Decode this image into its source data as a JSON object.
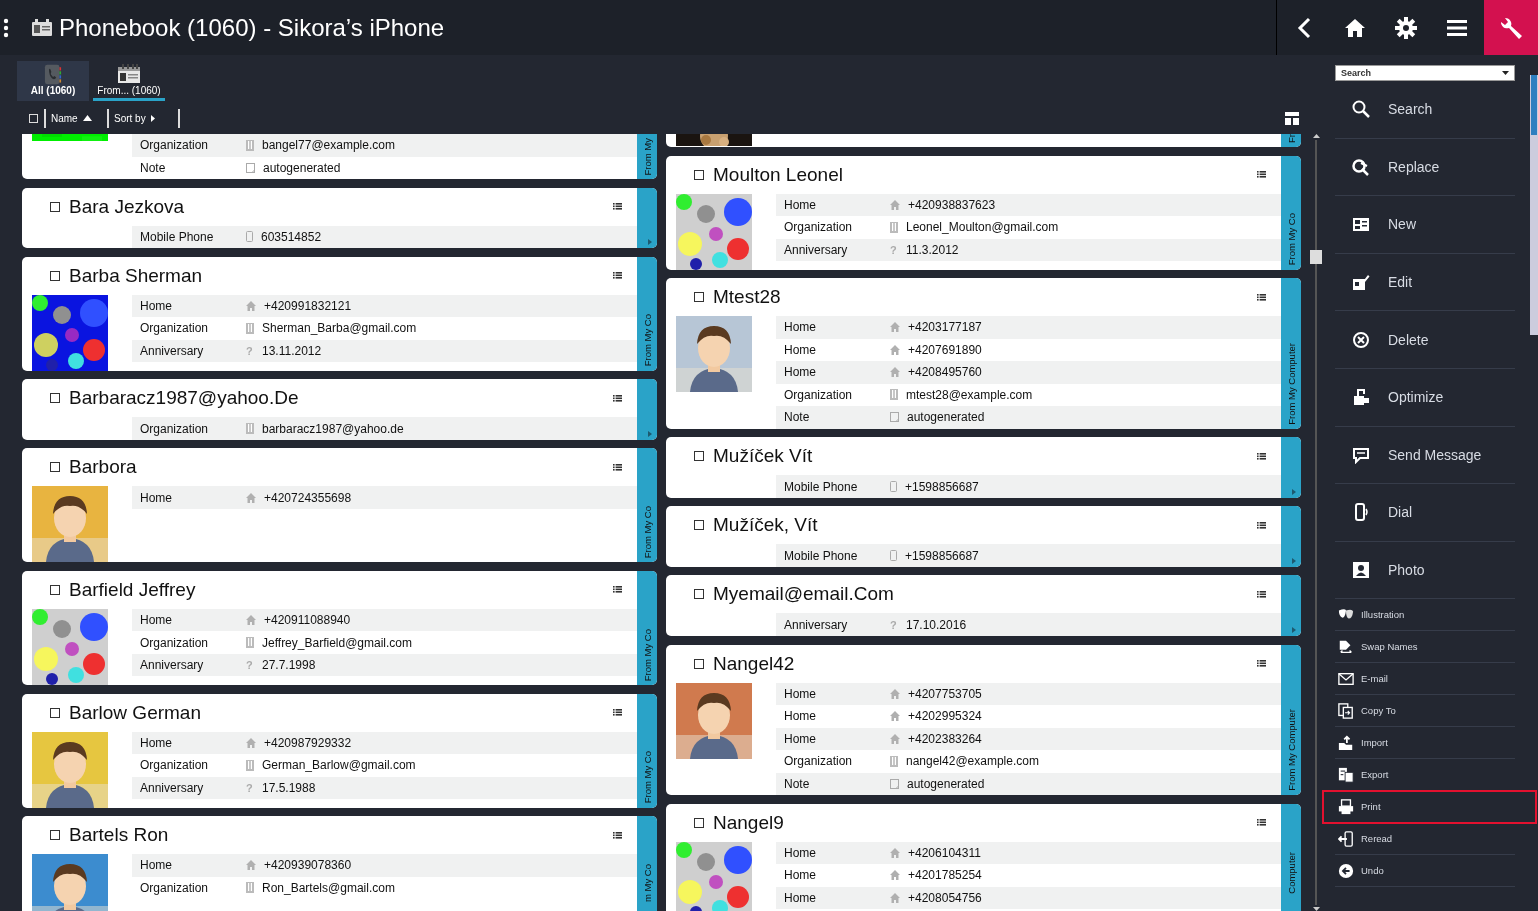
{
  "window": {
    "title": "Phonebook (1060) - Sikora’s iPhone"
  },
  "tabs": [
    {
      "label": "All (1060)",
      "selected": true
    },
    {
      "label": "From... (1060)",
      "selected": false
    }
  ],
  "sort_bar": {
    "checked": false,
    "name_column": "Name",
    "sort_by": "Sort by"
  },
  "columns": [
    [
      {
        "picture": {
          "kind": "picture"
        },
        "side_label": "From My",
        "rows": [
          {
            "kind": "organization",
            "label": "Organization",
            "value": "bangel77@example.com"
          },
          {
            "kind": "note",
            "label": "Note",
            "value": "autogenerated"
          }
        ]
      },
      {
        "name": "Bara Jezkova",
        "checked": false,
        "rows": [
          {
            "kind": "mobile",
            "label": "Mobile Phone",
            "value": "603514852"
          }
        ]
      },
      {
        "name": "Barba Sherman",
        "checked": false,
        "picture": {
          "kind": "picture"
        },
        "side_label": "From My Co",
        "rows": [
          {
            "kind": "home",
            "label": "Home",
            "value": "+420991832121"
          },
          {
            "kind": "organization",
            "label": "Organization",
            "value": "Sherman_Barba@gmail.com"
          },
          {
            "kind": "date",
            "label": "Anniversary",
            "glyph": "?",
            "value": "13.11.2012"
          }
        ]
      },
      {
        "name": "Barbaracz1987@yahoo.De",
        "checked": false,
        "rows": [
          {
            "kind": "organization",
            "label": "Organization",
            "value": "barbaracz1987@yahoo.de"
          }
        ]
      },
      {
        "name": "Barbora",
        "checked": false,
        "picture": {
          "kind": "picture"
        },
        "side_label": "From My Co",
        "rows": [
          {
            "kind": "home",
            "label": "Home",
            "value": "+420724355698"
          }
        ]
      },
      {
        "name": "Barfield Jeffrey",
        "checked": false,
        "picture": {
          "kind": "picture"
        },
        "side_label": "From My Co",
        "rows": [
          {
            "kind": "home",
            "label": "Home",
            "value": "+420911088940"
          },
          {
            "kind": "organization",
            "label": "Organization",
            "value": "Jeffrey_Barfield@gmail.com"
          },
          {
            "kind": "date",
            "label": "Anniversary",
            "glyph": "?",
            "value": "27.7.1998"
          }
        ]
      },
      {
        "name": "Barlow German",
        "checked": false,
        "picture": {
          "kind": "picture"
        },
        "side_label": "From My Co",
        "rows": [
          {
            "kind": "home",
            "label": "Home",
            "value": "+420987929332"
          },
          {
            "kind": "organization",
            "label": "Organization",
            "value": "German_Barlow@gmail.com"
          },
          {
            "kind": "date",
            "label": "Anniversary",
            "glyph": "?",
            "value": "17.5.1988"
          }
        ]
      },
      {
        "name": "Bartels Ron",
        "checked": false,
        "picture": {
          "kind": "picture"
        },
        "side_label": "m My Co",
        "rows": [
          {
            "kind": "home",
            "label": "Home",
            "value": "+420939078360"
          },
          {
            "kind": "organization",
            "label": "Organization",
            "value": "Ron_Bartels@gmail.com"
          }
        ]
      }
    ],
    [
      {
        "picture": {
          "kind": "picture"
        },
        "side_label": "Fr"
      },
      {
        "name": "Moulton Leonel",
        "checked": false,
        "picture": {
          "kind": "picture"
        },
        "side_label": "From My Co",
        "rows": [
          {
            "kind": "home",
            "label": "Home",
            "value": "+420938837623"
          },
          {
            "kind": "organization",
            "label": "Organization",
            "value": "Leonel_Moulton@gmail.com"
          },
          {
            "kind": "date",
            "label": "Anniversary",
            "glyph": "?",
            "value": "11.3.2012"
          }
        ]
      },
      {
        "name": "Mtest28",
        "checked": false,
        "picture": {
          "kind": "picture"
        },
        "side_label": "From My Computer",
        "rows": [
          {
            "kind": "home",
            "label": "Home",
            "value": "+4203177187"
          },
          {
            "kind": "home",
            "label": "Home",
            "value": "+4207691890"
          },
          {
            "kind": "home",
            "label": "Home",
            "value": "+4208495760"
          },
          {
            "kind": "organization",
            "label": "Organization",
            "value": "mtest28@example.com"
          },
          {
            "kind": "note",
            "label": "Note",
            "value": "autogenerated"
          }
        ]
      },
      {
        "name": "Mužíček Vít",
        "checked": false,
        "rows": [
          {
            "kind": "mobile",
            "label": "Mobile Phone",
            "value": "+1598856687"
          }
        ]
      },
      {
        "name": "Mužíček, Vít",
        "checked": false,
        "rows": [
          {
            "kind": "mobile",
            "label": "Mobile Phone",
            "value": "+1598856687"
          }
        ]
      },
      {
        "name": "Myemail@email.Com",
        "checked": false,
        "rows": [
          {
            "kind": "date",
            "label": "Anniversary",
            "glyph": "?",
            "value": "17.10.2016"
          }
        ]
      },
      {
        "name": "Nangel42",
        "checked": false,
        "picture": {
          "kind": "picture"
        },
        "side_label": "From My Computer",
        "rows": [
          {
            "kind": "home",
            "label": "Home",
            "value": "+4207753705"
          },
          {
            "kind": "home",
            "label": "Home",
            "value": "+4202995324"
          },
          {
            "kind": "home",
            "label": "Home",
            "value": "+4202383264"
          },
          {
            "kind": "organization",
            "label": "Organization",
            "value": "nangel42@example.com"
          },
          {
            "kind": "note",
            "label": "Note",
            "value": "autogenerated"
          }
        ]
      },
      {
        "name": "Nangel9",
        "checked": false,
        "picture": {
          "kind": "picture"
        },
        "side_label": "Computer",
        "rows": [
          {
            "kind": "home",
            "label": "Home",
            "value": "+4206104311"
          },
          {
            "kind": "home",
            "label": "Home",
            "value": "+4201785254"
          },
          {
            "kind": "home",
            "label": "Home",
            "value": "+4208054756"
          }
        ]
      }
    ]
  ],
  "side_panel": {
    "dropdown": {
      "value": "Search"
    },
    "actions": [
      {
        "kind": "large",
        "label": "Search",
        "selected": false
      },
      {
        "kind": "large",
        "label": "Replace",
        "selected": false
      },
      {
        "kind": "large",
        "label": "New",
        "selected": false
      },
      {
        "kind": "large",
        "label": "Edit",
        "selected": false
      },
      {
        "kind": "large",
        "label": "Delete",
        "selected": false
      },
      {
        "kind": "large",
        "label": "Optimize",
        "selected": false
      },
      {
        "kind": "large",
        "label": "Send Message",
        "selected": false
      },
      {
        "kind": "large",
        "label": "Dial",
        "selected": false
      },
      {
        "kind": "large",
        "label": "Photo",
        "selected": false
      },
      {
        "kind": "small",
        "label": "Illustration",
        "selected": false
      },
      {
        "kind": "small",
        "label": "Swap Names",
        "selected": false
      },
      {
        "kind": "small",
        "label": "E-mail",
        "selected": false
      },
      {
        "kind": "small",
        "label": "Copy To",
        "selected": false
      },
      {
        "kind": "small",
        "label": "Import",
        "selected": false
      },
      {
        "kind": "small",
        "label": "Export",
        "selected": false
      },
      {
        "kind": "small",
        "label": "Print",
        "selected": true
      },
      {
        "kind": "small",
        "label": "Reread",
        "selected": false
      },
      {
        "kind": "small",
        "label": "Undo",
        "selected": false
      }
    ]
  }
}
